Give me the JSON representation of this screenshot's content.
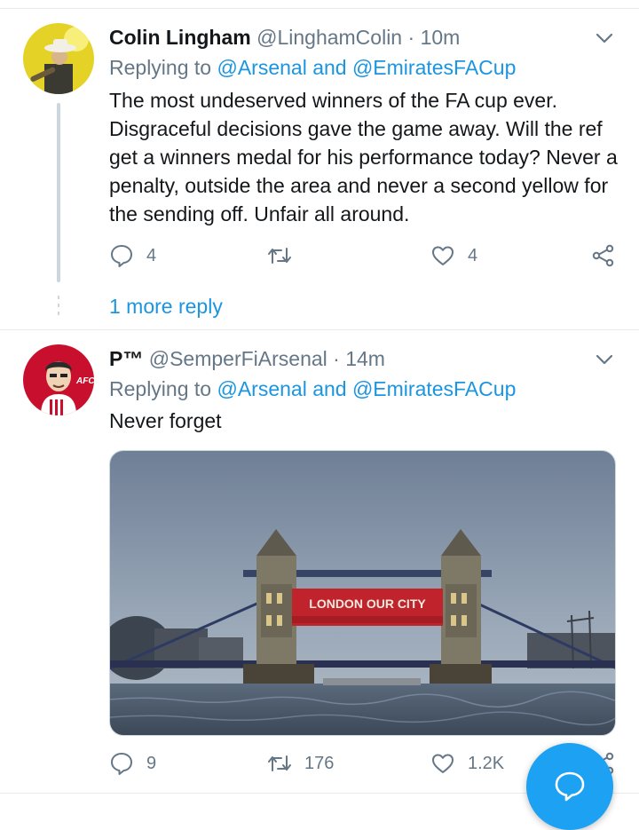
{
  "tweets": [
    {
      "display_name": "Colin Lingham",
      "handle": "@LinghamColin",
      "separator": "·",
      "time": "10m",
      "replying_prefix": "Replying to",
      "replying_to": "@Arsenal and @EmiratesFACup",
      "text": "The most undeserved winners of the FA cup ever. Disgraceful decisions gave the game away.  Will the ref get a winners medal for his performance today? Never a penalty, outside the area and never a second yellow for the sending off.  Unfair all around.",
      "reply_count": "4",
      "retweet_count": "",
      "like_count": "4",
      "more_replies": "1 more reply"
    },
    {
      "display_name": "P™",
      "handle": "@SemperFiArsenal",
      "separator": "·",
      "time": "14m",
      "replying_prefix": "Replying to",
      "replying_to": "@Arsenal and @EmiratesFACup",
      "text": "Never forget",
      "reply_count": "9",
      "retweet_count": "176",
      "like_count": "1.2K",
      "banner_text": "LONDON OUR CITY"
    }
  ],
  "colors": {
    "link": "#1b95e0",
    "muted": "#657786",
    "fab": "#1da1f2"
  },
  "icons": [
    "chevron-down-icon",
    "reply-icon",
    "retweet-icon",
    "like-icon",
    "share-icon",
    "compose-reply-icon"
  ]
}
